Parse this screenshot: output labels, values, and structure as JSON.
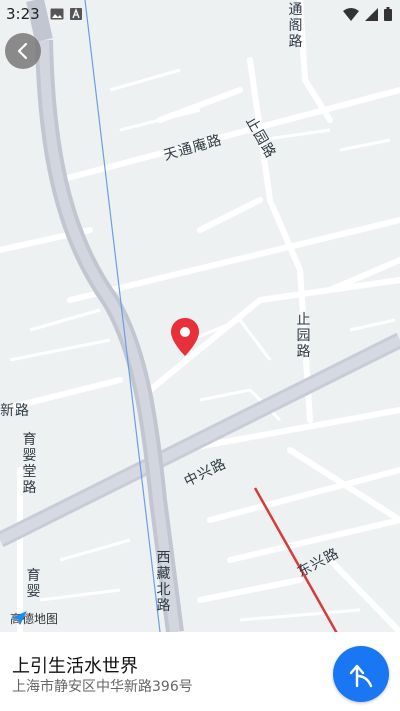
{
  "status_bar": {
    "time": "3:23",
    "icons": [
      "image-icon",
      "text-icon",
      "wifi-icon",
      "signal-icon",
      "battery-icon"
    ]
  },
  "map": {
    "roads": {
      "tongge_road": "通阁路",
      "tiantong_an_road": "天通庵路",
      "zhiyuan_road_top": "止园路",
      "zhiyuan_road_mid": "止园路",
      "xin_road": "新路",
      "yuying_tang_road": "育婴堂路",
      "zhongxing_road": "中兴路",
      "xizang_north_road": "西藏北路",
      "yuying_lower": "育婴",
      "dongxing_road": "东兴路"
    },
    "logo": "高德地图",
    "accent_color": "#1977f3",
    "pin_color": "#e8303a"
  },
  "place": {
    "name": "上引生活水世界",
    "address": "上海市静安区中华新路396号"
  }
}
